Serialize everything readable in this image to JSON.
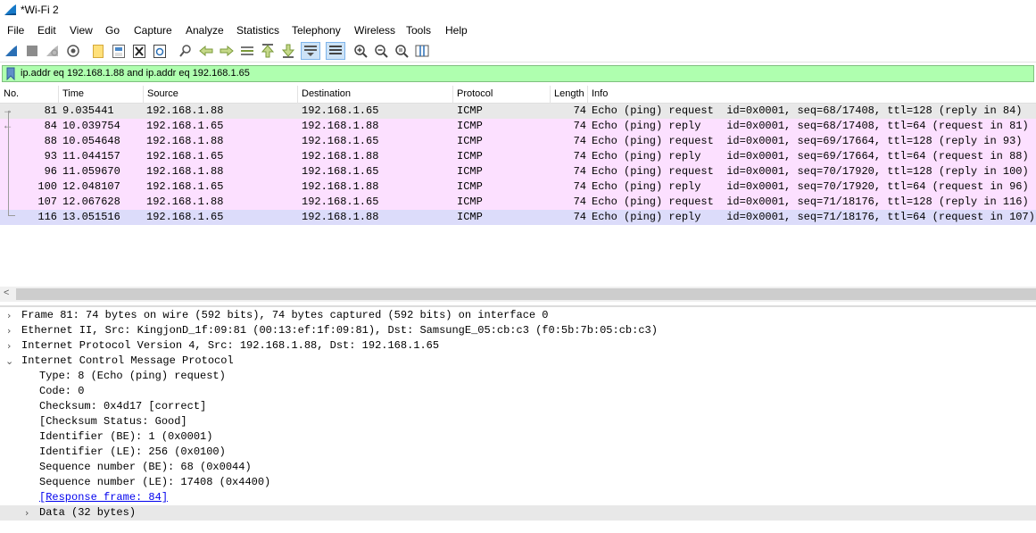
{
  "window": {
    "title": "*Wi-Fi 2"
  },
  "menu": [
    "File",
    "Edit",
    "View",
    "Go",
    "Capture",
    "Analyze",
    "Statistics",
    "Telephony",
    "Wireless",
    "Tools",
    "Help"
  ],
  "toolbar": {
    "icons": [
      "start-capture-icon",
      "stop-capture-icon",
      "restart-capture-icon",
      "capture-options-icon",
      "open-file-icon",
      "save-file-icon",
      "close-file-icon",
      "reload-file-icon",
      "find-packet-icon",
      "go-back-icon",
      "go-forward-icon",
      "go-to-packet-icon",
      "go-first-icon",
      "go-last-icon",
      "autoscroll-icon",
      "colorize-icon",
      "zoom-in-icon",
      "zoom-out-icon",
      "zoom-normal-icon",
      "resize-columns-icon"
    ]
  },
  "filter": {
    "value": "ip.addr eq 192.168.1.88 and ip.addr eq 192.168.1.65"
  },
  "packet_list": {
    "columns": [
      "No.",
      "Time",
      "Source",
      "Destination",
      "Protocol",
      "Length",
      "Info"
    ],
    "rows": [
      {
        "no": "81",
        "time": "9.035441",
        "src": "192.168.1.88",
        "dst": "192.168.1.65",
        "proto": "ICMP",
        "len": "74",
        "info": "Echo (ping) request  id=0x0001, seq=68/17408, ttl=128 (reply in 84)"
      },
      {
        "no": "84",
        "time": "10.039754",
        "src": "192.168.1.65",
        "dst": "192.168.1.88",
        "proto": "ICMP",
        "len": "74",
        "info": "Echo (ping) reply    id=0x0001, seq=68/17408, ttl=64 (request in 81)"
      },
      {
        "no": "88",
        "time": "10.054648",
        "src": "192.168.1.88",
        "dst": "192.168.1.65",
        "proto": "ICMP",
        "len": "74",
        "info": "Echo (ping) request  id=0x0001, seq=69/17664, ttl=128 (reply in 93)"
      },
      {
        "no": "93",
        "time": "11.044157",
        "src": "192.168.1.65",
        "dst": "192.168.1.88",
        "proto": "ICMP",
        "len": "74",
        "info": "Echo (ping) reply    id=0x0001, seq=69/17664, ttl=64 (request in 88)"
      },
      {
        "no": "96",
        "time": "11.059670",
        "src": "192.168.1.88",
        "dst": "192.168.1.65",
        "proto": "ICMP",
        "len": "74",
        "info": "Echo (ping) request  id=0x0001, seq=70/17920, ttl=128 (reply in 100)"
      },
      {
        "no": "100",
        "time": "12.048107",
        "src": "192.168.1.65",
        "dst": "192.168.1.88",
        "proto": "ICMP",
        "len": "74",
        "info": "Echo (ping) reply    id=0x0001, seq=70/17920, ttl=64 (request in 96)"
      },
      {
        "no": "107",
        "time": "12.067628",
        "src": "192.168.1.88",
        "dst": "192.168.1.65",
        "proto": "ICMP",
        "len": "74",
        "info": "Echo (ping) request  id=0x0001, seq=71/18176, ttl=128 (reply in 116)"
      },
      {
        "no": "116",
        "time": "13.051516",
        "src": "192.168.1.65",
        "dst": "192.168.1.88",
        "proto": "ICMP",
        "len": "74",
        "info": "Echo (ping) reply    id=0x0001, seq=71/18176, ttl=64 (request in 107)"
      }
    ]
  },
  "details": {
    "frame": "Frame 81: 74 bytes on wire (592 bits), 74 bytes captured (592 bits) on interface 0",
    "ethernet": "Ethernet II, Src: KingjonD_1f:09:81 (00:13:ef:1f:09:81), Dst: SamsungE_05:cb:c3 (f0:5b:7b:05:cb:c3)",
    "ip": "Internet Protocol Version 4, Src: 192.168.1.88, Dst: 192.168.1.65",
    "icmp": "Internet Control Message Protocol",
    "icmp_fields": [
      "Type: 8 (Echo (ping) request)",
      "Code: 0",
      "Checksum: 0x4d17 [correct]",
      "[Checksum Status: Good]",
      "Identifier (BE): 1 (0x0001)",
      "Identifier (LE): 256 (0x0100)",
      "Sequence number (BE): 68 (0x0044)",
      "Sequence number (LE): 17408 (0x4400)"
    ],
    "response_link": "[Response frame: 84]",
    "data": "Data (32 bytes)"
  },
  "colors": {
    "filter_ok": "#afffaf",
    "icmp_row": "#fce0ff",
    "selected_row": "#dcdcfa",
    "link": "#0000ee"
  }
}
